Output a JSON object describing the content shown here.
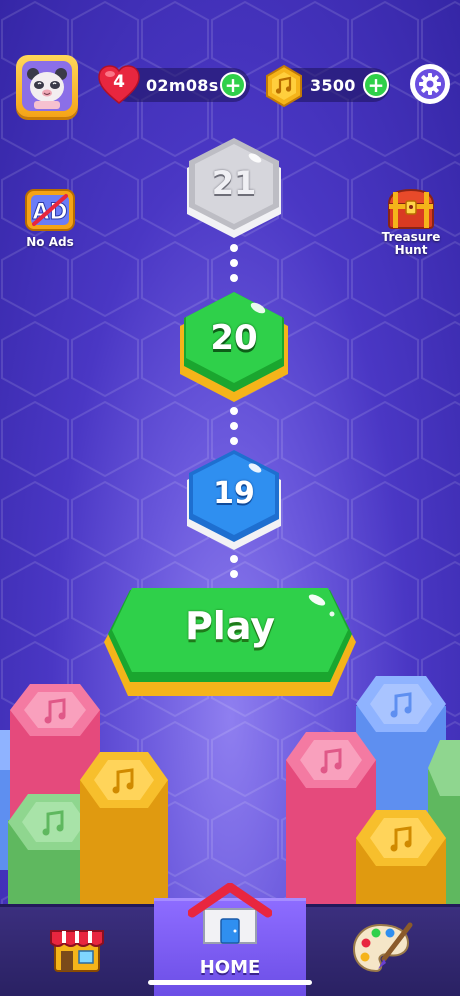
{
  "top_bar": {
    "lives_count": "4",
    "lives_timer": "02m08s",
    "coins": "3500",
    "add_symbol": "+"
  },
  "side": {
    "no_ads_label": "No Ads",
    "no_ads_icon_text": "AD",
    "treasure_label_1": "Treasure",
    "treasure_label_2": "Hunt"
  },
  "levels": {
    "next_locked": "21",
    "current": "20",
    "completed": "19"
  },
  "play": {
    "label": "Play"
  },
  "nav": {
    "tabs": [
      {
        "name": "shop",
        "label": ""
      },
      {
        "name": "home",
        "label": "HOME"
      },
      {
        "name": "paint",
        "label": ""
      }
    ]
  },
  "colors": {
    "background": "#4a37c4",
    "green": "#2fd04a",
    "blue": "#2f8ff0",
    "pink": "#f2618e",
    "yellow": "#f5b41a",
    "gray": "#c9c9cf"
  }
}
